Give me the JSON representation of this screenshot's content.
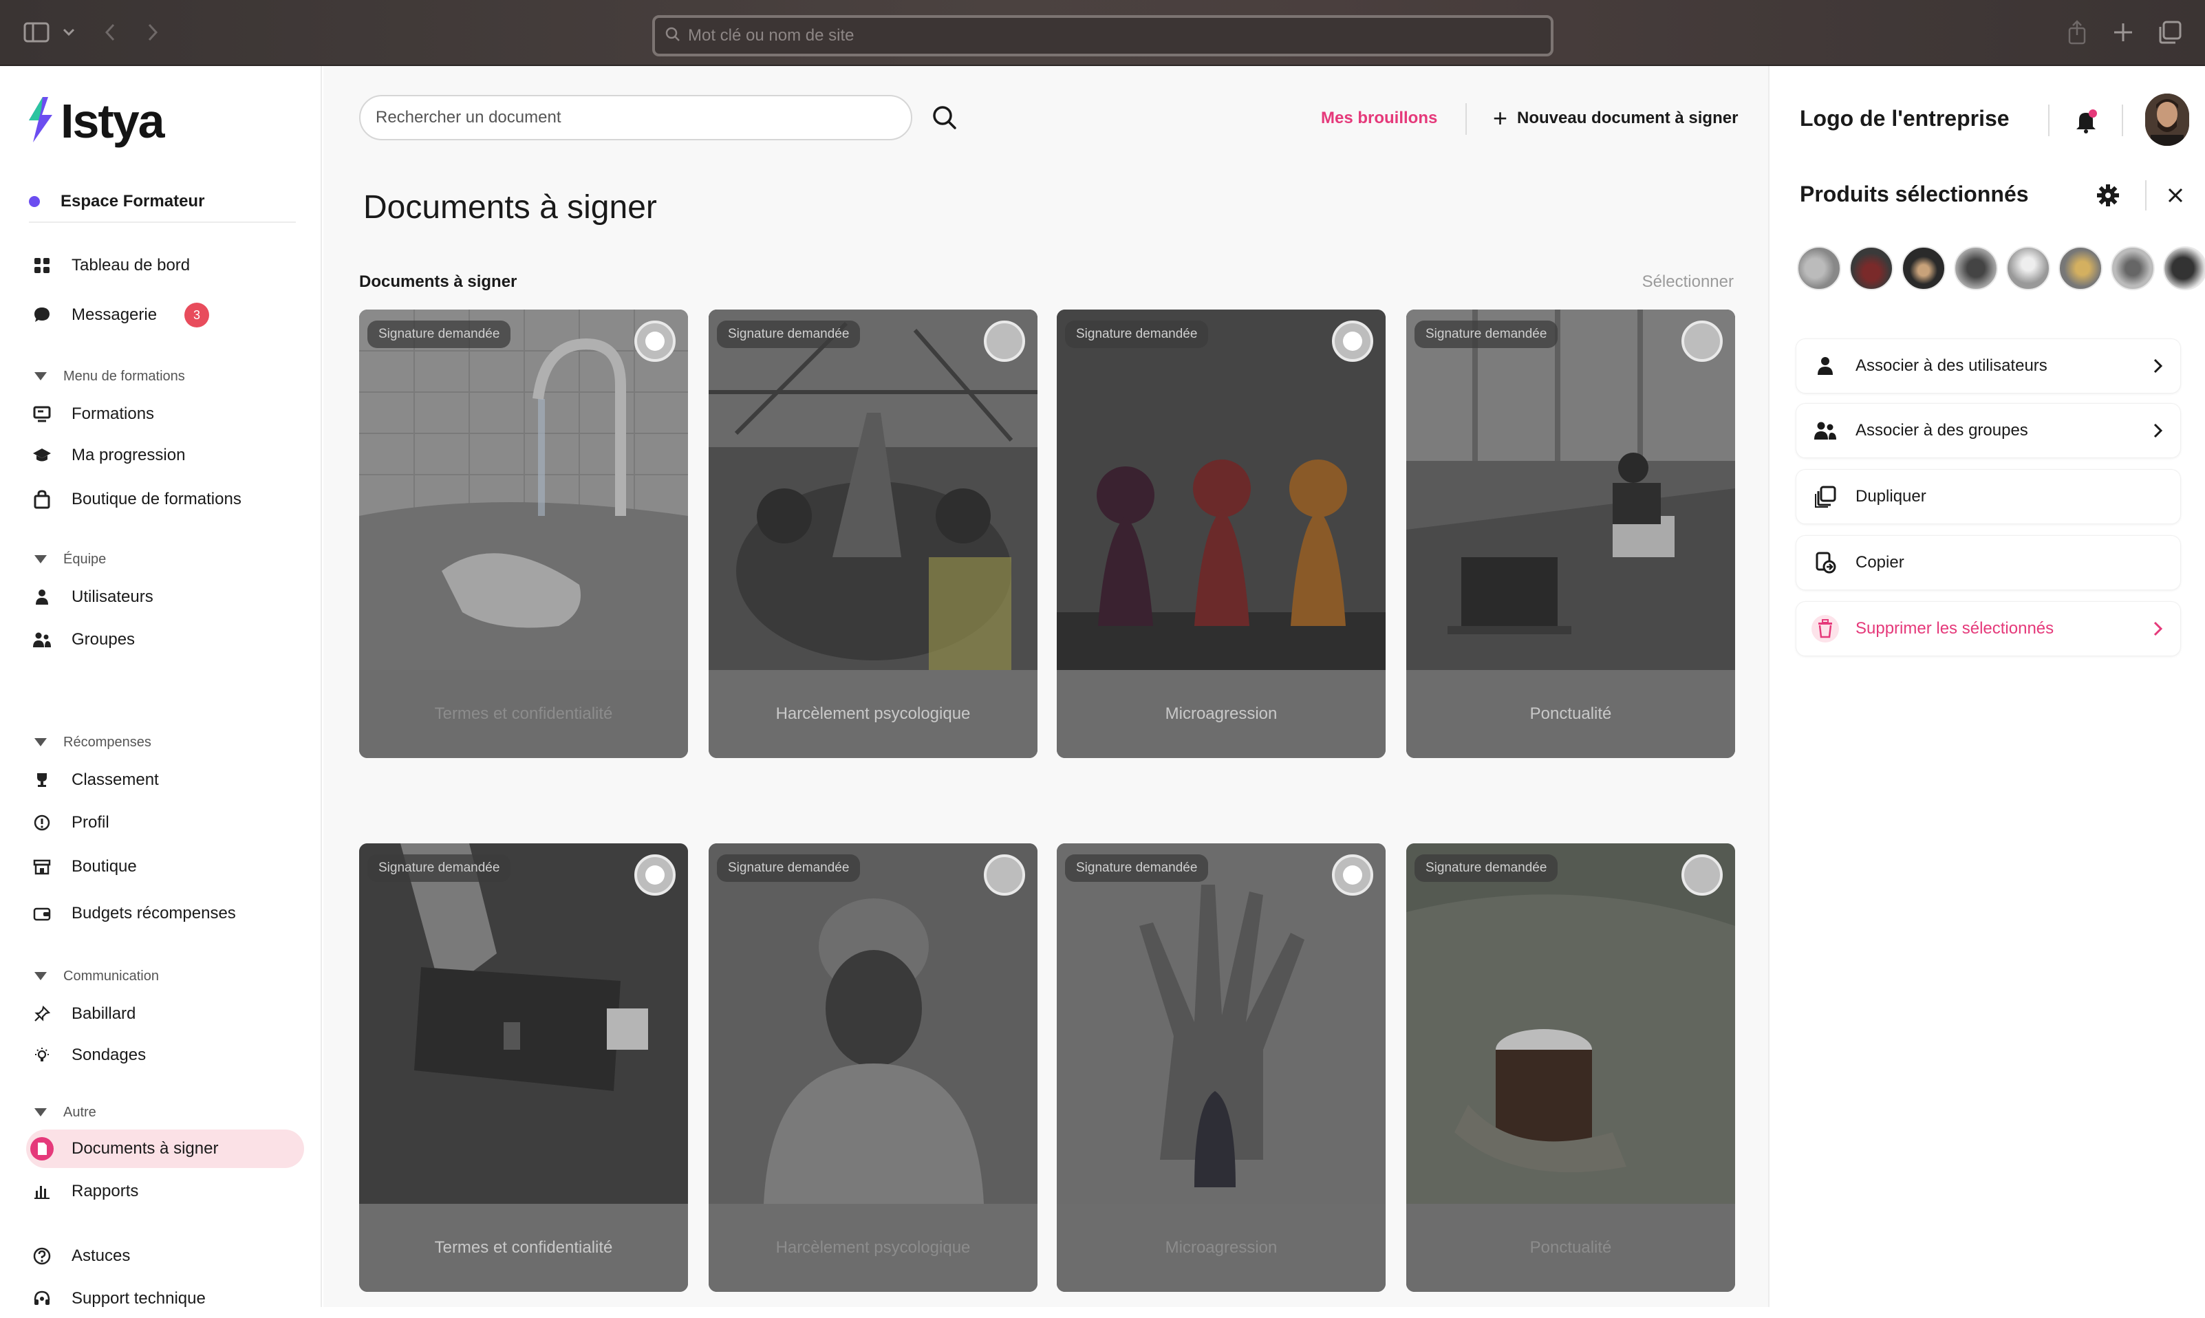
{
  "browser": {
    "url_placeholder": "Mot clé ou nom de site"
  },
  "brand": {
    "name": "Istya",
    "accent": "#e5397a",
    "purple": "#6b4df0"
  },
  "sidebar": {
    "space": "Espace Formateur",
    "top_items": [
      {
        "label": "Tableau de bord",
        "icon": "dashboard-icon"
      },
      {
        "label": "Messagerie",
        "icon": "chat-icon",
        "badge": "3"
      }
    ],
    "groups": [
      {
        "title": "Menu de formations",
        "items": [
          {
            "label": "Formations",
            "icon": "board-icon"
          },
          {
            "label": "Ma progression",
            "icon": "graduation-cap-icon"
          },
          {
            "label": "Boutique de formations",
            "icon": "shopping-bag-icon"
          }
        ]
      },
      {
        "title": "Équipe",
        "items": [
          {
            "label": "Utilisateurs",
            "icon": "user-icon"
          },
          {
            "label": "Groupes",
            "icon": "users-icon"
          }
        ]
      },
      {
        "title": "Récompenses",
        "items": [
          {
            "label": "Classement",
            "icon": "trophy-icon"
          },
          {
            "label": "Profil",
            "icon": "info-icon"
          },
          {
            "label": "Boutique",
            "icon": "store-icon"
          },
          {
            "label": "Budgets récompenses",
            "icon": "wallet-icon"
          }
        ]
      },
      {
        "title": "Communication",
        "items": [
          {
            "label": "Babillard",
            "icon": "pin-icon"
          },
          {
            "label": "Sondages",
            "icon": "bulb-icon"
          }
        ]
      },
      {
        "title": "Autre",
        "items": [
          {
            "label": "Documents à signer",
            "icon": "document-icon",
            "active": true
          },
          {
            "label": "Rapports",
            "icon": "bar-chart-icon"
          }
        ]
      }
    ],
    "bottom_items": [
      {
        "label": "Astuces",
        "icon": "question-icon"
      },
      {
        "label": "Support technique",
        "icon": "headset-icon"
      }
    ]
  },
  "main": {
    "search_placeholder": "Rechercher un document",
    "drafts_label": "Mes brouillons",
    "new_doc_label": "Nouveau document à signer",
    "page_title": "Documents à signer",
    "section_title": "Documents à signer",
    "select_label": "Sélectionner",
    "tag_label": "Signature demandée",
    "cards": [
      {
        "title": "Termes et confidentialité",
        "selected": true,
        "image": "faucet-hands"
      },
      {
        "title": "Harcèlement psycologique",
        "selected": false,
        "image": "team-hands"
      },
      {
        "title": "Microagression",
        "selected": true,
        "image": "wooden-pawns"
      },
      {
        "title": "Ponctualité",
        "selected": false,
        "image": "office-desk"
      },
      {
        "title": "Termes et confidentialité",
        "selected": true,
        "image": "architecture"
      },
      {
        "title": "Harcèlement psycologique",
        "selected": false,
        "image": "man-beanie"
      },
      {
        "title": "Microagression",
        "selected": true,
        "image": "hand-window"
      },
      {
        "title": "Ponctualité",
        "selected": false,
        "image": "coffee-cup"
      }
    ]
  },
  "panel": {
    "company_logo_label": "Logo de l'entreprise",
    "title": "Produits sélectionnés",
    "thumb_count": 8,
    "actions": [
      {
        "label": "Associer à des utilisateurs",
        "icon": "user-icon",
        "chevron": true
      },
      {
        "label": "Associer à des groupes",
        "icon": "users-icon",
        "chevron": true
      },
      {
        "label": "Dupliquer",
        "icon": "duplicate-icon",
        "chevron": false
      },
      {
        "label": "Copier",
        "icon": "copy-icon",
        "chevron": false
      },
      {
        "label": "Supprimer les sélectionnés",
        "icon": "trash-icon",
        "chevron": true,
        "danger": true
      }
    ]
  }
}
